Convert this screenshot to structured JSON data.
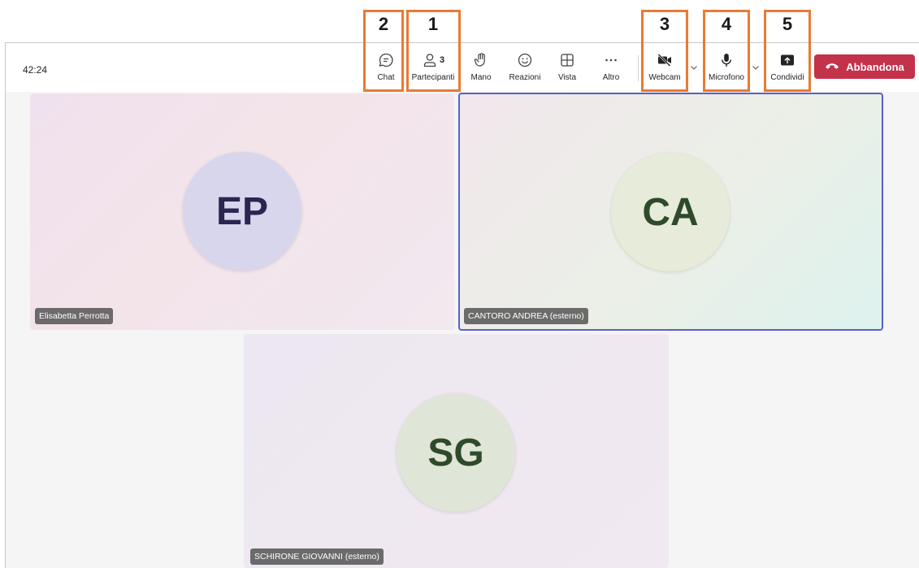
{
  "meeting": {
    "timer": "42:24"
  },
  "toolbar": {
    "chat_label": "Chat",
    "participants_label": "Partecipanti",
    "participants_count": "3",
    "hand_label": "Mano",
    "reactions_label": "Reazioni",
    "view_label": "Vista",
    "more_label": "Altro",
    "webcam_label": "Webcam",
    "mic_label": "Microfono",
    "share_label": "Condividi",
    "leave_label": "Abbandona"
  },
  "annotations": [
    "2",
    "1",
    "3",
    "4",
    "5"
  ],
  "participants": [
    {
      "initials": "EP",
      "name": "Elisabetta Perrotta"
    },
    {
      "initials": "CA",
      "name": "CANTORO ANDREA (esterno)"
    },
    {
      "initials": "SG",
      "name": "SCHIRONE GIOVANNI (esterno)"
    }
  ],
  "colors": {
    "leave_button": "#c4314b",
    "active_speaker_border": "#5b5fc7",
    "annotation": "#ea7a33"
  }
}
